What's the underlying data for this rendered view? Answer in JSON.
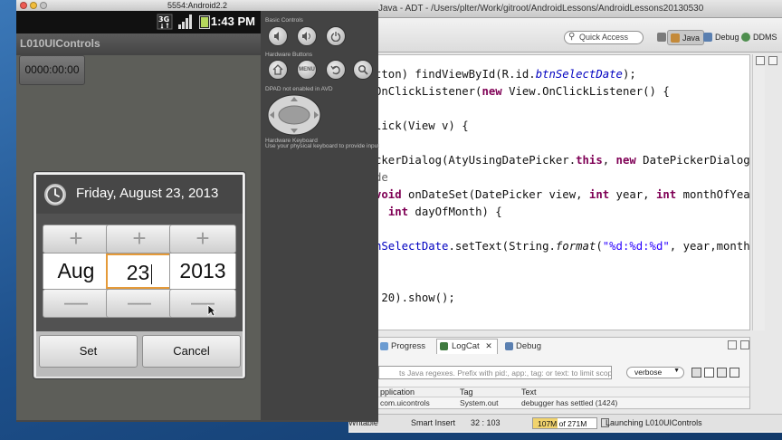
{
  "eclipse": {
    "title": "Java - ADT - /Users/plter/Work/gitroot/AndroidLessons/AndroidLessons20130530",
    "quick_access": "Quick Access",
    "perspectives": [
      "Java",
      "Debug",
      "DDMS"
    ],
    "code_lines": [
      {
        "parts": [
          [
            "plain",
            "tton) findViewById(R.id."
          ],
          [
            "fld",
            "btnSelectDate"
          ],
          [
            "plain",
            ");"
          ]
        ]
      },
      {
        "parts": [
          [
            "plain",
            "OnClickListener("
          ],
          [
            "kw",
            "new"
          ],
          [
            "plain",
            " View.OnClickListener() {"
          ]
        ]
      },
      {
        "parts": []
      },
      {
        "parts": [
          [
            "plain",
            "lick(View v) {"
          ]
        ]
      },
      {
        "parts": []
      },
      {
        "parts": [
          [
            "plain",
            "ckerDialog(AtyUsingDatePicker."
          ],
          [
            "kw",
            "this"
          ],
          [
            "plain",
            ", "
          ],
          [
            "kw",
            "new"
          ],
          [
            "plain",
            " DatePickerDialog.OnDa"
          ]
        ]
      },
      {
        "parts": [
          [
            "ann",
            "de"
          ]
        ]
      },
      {
        "parts": [
          [
            "kw",
            "void"
          ],
          [
            "plain",
            " onDateSet(DatePicker view, "
          ],
          [
            "kw",
            "int"
          ],
          [
            "plain",
            " year, "
          ],
          [
            "kw",
            "int"
          ],
          [
            "plain",
            " monthOfYear,"
          ]
        ]
      },
      {
        "parts": [
          [
            "plain",
            "  "
          ],
          [
            "kw",
            "int"
          ],
          [
            "plain",
            " dayOfMonth) {"
          ]
        ]
      },
      {
        "parts": []
      },
      {
        "parts": [
          [
            "var",
            "nSelectDate"
          ],
          [
            "plain",
            ".setText(String."
          ],
          [
            "itl",
            "format"
          ],
          [
            "plain",
            "("
          ],
          [
            "str",
            "\"%d:%d:%d\""
          ],
          [
            "plain",
            ", year,monthOfYea"
          ]
        ]
      },
      {
        "parts": []
      },
      {
        "parts": []
      },
      {
        "parts": [
          [
            "plain",
            " 20).show();"
          ]
        ]
      }
    ],
    "bottom_tabs": [
      "Progress",
      "LogCat",
      "Debug"
    ],
    "logcat_filter_placeholder": "ts Java regexes. Prefix with pid:, app:, tag: or text: to limit scope.",
    "log_level": "verbose",
    "log_columns": [
      "pplication",
      "Tag",
      "Text"
    ],
    "log_row": [
      "com.uicontrols",
      "System.out",
      "debugger has settled (1424)"
    ],
    "status": {
      "writable": "Writable",
      "insert_mode": "Smart Insert",
      "position": "32 : 103",
      "heap": "107M of 271M",
      "heap_fraction": 0.39,
      "launch": "Launching L010UIControls"
    }
  },
  "emulator": {
    "title": "5554:Android2.2",
    "time": "1:43 PM",
    "network": "3G",
    "app_title": "L010UIControls",
    "date_button": "0000:00:00",
    "dialog": {
      "title": "Friday, August 23, 2013",
      "columns": [
        {
          "value": "Aug",
          "focused": false
        },
        {
          "value": "23",
          "focused": true
        },
        {
          "value": "2013",
          "focused": false
        }
      ],
      "plus_glyph": "+",
      "minus_glyph": "—",
      "set_label": "Set",
      "cancel_label": "Cancel"
    },
    "controls": {
      "basic_label": "Basic Controls",
      "hardware_label": "Hardware Buttons",
      "menu_label": "MENU",
      "dpad_label": "DPAD not enabled in AVD",
      "keyboard_label": "Hardware Keyboard",
      "keyboard_hint": "Use your physical keyboard to provide input"
    }
  },
  "colors": {
    "picker_focus": "#e59a39",
    "heap_fill": "#f1d36d",
    "keyword": "#7f0055",
    "field": "#0000c0",
    "string": "#2a00ff"
  }
}
